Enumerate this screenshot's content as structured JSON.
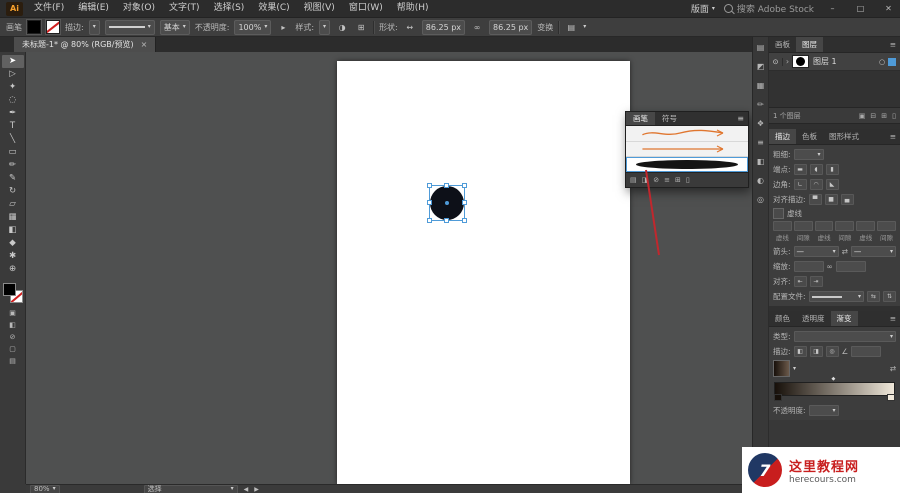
{
  "colors": {
    "accent_blue": "#4f9bd8",
    "annotation_red": "#c1272d",
    "brush_orange": "#e0762f",
    "watermark_red": "#c81e1e",
    "watermark_navy": "#203864",
    "object_fill": "#0d1018"
  },
  "icons": {
    "caret_down": "▾",
    "caret_right": "▸",
    "menu": "≡",
    "swap": "⇄",
    "link": "∞",
    "width": "↔",
    "angle": "∠",
    "expand": "›",
    "eye": "⊙",
    "target": "○",
    "prev": "◀",
    "next": "▶",
    "minimize": "–",
    "maximize": "□",
    "close": "✕",
    "tab_close": "×",
    "recolor": "◑",
    "align_grid": "⊞",
    "more": "▤",
    "diamond": "◆",
    "flip_h": "⇆",
    "flip_v": "⇅"
  },
  "menubar": {
    "logo": "Ai",
    "items": [
      {
        "label": "文件(F)"
      },
      {
        "label": "编辑(E)"
      },
      {
        "label": "对象(O)"
      },
      {
        "label": "文字(T)"
      },
      {
        "label": "选择(S)"
      },
      {
        "label": "效果(C)"
      },
      {
        "label": "视图(V)"
      },
      {
        "label": "窗口(W)"
      },
      {
        "label": "帮助(H)"
      }
    ],
    "workspace": "版面",
    "search_label": "搜索 Adobe Stock"
  },
  "controlbar": {
    "context_label": "画笔",
    "stroke_label": "描边:",
    "brush_definition": "基本",
    "opacity_label": "不透明度:",
    "opacity_value": "100%",
    "style_label": "样式:",
    "shape_label": "形状:",
    "width_value": "86.25 px",
    "height_value": "86.25 px",
    "transform_label": "变换"
  },
  "tabbar": {
    "title": "未标题-1* @ 80% (RGB/预览)"
  },
  "toolbar": {
    "tools": [
      {
        "name": "selection",
        "glyph": "➤"
      },
      {
        "name": "direct-selection",
        "glyph": "▷"
      },
      {
        "name": "magic-wand",
        "glyph": "✦"
      },
      {
        "name": "lasso",
        "glyph": "◌"
      },
      {
        "name": "pen",
        "glyph": "✒"
      },
      {
        "name": "type",
        "glyph": "T"
      },
      {
        "name": "line-segment",
        "glyph": "╲"
      },
      {
        "name": "rectangle",
        "glyph": "▭"
      },
      {
        "name": "paintbrush",
        "glyph": "✏"
      },
      {
        "name": "pencil",
        "glyph": "✎"
      },
      {
        "name": "rotate",
        "glyph": "↻"
      },
      {
        "name": "scale",
        "glyph": "▱"
      },
      {
        "name": "mesh",
        "glyph": "▦"
      },
      {
        "name": "gradient",
        "glyph": "◧"
      },
      {
        "name": "eyedropper",
        "glyph": "◆"
      },
      {
        "name": "hand",
        "glyph": "✱"
      },
      {
        "name": "zoom",
        "glyph": "⊕"
      }
    ],
    "mode_icons": [
      {
        "name": "color-fill-button",
        "glyph": "▣"
      },
      {
        "name": "color-gradient-button",
        "glyph": "◧"
      },
      {
        "name": "color-none-button",
        "glyph": "⊘"
      },
      {
        "name": "draw-mode-button",
        "glyph": "▢"
      },
      {
        "name": "screen-mode-button",
        "glyph": "▤"
      }
    ]
  },
  "float_panel": {
    "tabs": [
      {
        "label": "画笔"
      },
      {
        "label": "符号"
      }
    ],
    "footer_icons": [
      {
        "name": "brush-libraries-icon",
        "glyph": "▤"
      },
      {
        "name": "libraries-panel-icon",
        "glyph": "◨"
      },
      {
        "name": "remove-brush-stroke-icon",
        "glyph": "⊘"
      },
      {
        "name": "options-icon",
        "glyph": "≡"
      },
      {
        "name": "new-brush-icon",
        "glyph": "⊞"
      },
      {
        "name": "delete-brush-icon",
        "glyph": "▯"
      }
    ]
  },
  "dock": {
    "strip_icons": [
      {
        "name": "color-panel-icon",
        "glyph": "▤"
      },
      {
        "name": "color-guide-icon",
        "glyph": "◩"
      },
      {
        "name": "swatches-panel-icon",
        "glyph": "▦"
      },
      {
        "name": "brushes-panel-icon",
        "glyph": "✏"
      },
      {
        "name": "symbols-panel-icon",
        "glyph": "❖"
      },
      {
        "name": "stroke-panel-icon",
        "glyph": "≡"
      },
      {
        "name": "gradient-panel-icon",
        "glyph": "◧"
      },
      {
        "name": "transparency-panel-icon",
        "glyph": "◐"
      },
      {
        "name": "appearance-panel-icon",
        "glyph": "◎"
      }
    ],
    "layers": {
      "tabs": [
        {
          "label": "画板"
        },
        {
          "label": "图层"
        }
      ],
      "layer_name": "图层 1",
      "status": "1 个图层",
      "footer_icons": [
        {
          "name": "make-clipping-mask-icon",
          "glyph": "▣"
        },
        {
          "name": "new-sublayer-icon",
          "glyph": "⊟"
        },
        {
          "name": "new-layer-icon",
          "glyph": "⊞"
        },
        {
          "name": "delete-layer-icon",
          "glyph": "▯"
        }
      ]
    },
    "stroke": {
      "tabs": [
        {
          "label": "描边"
        },
        {
          "label": "色板"
        },
        {
          "label": "图形样式"
        }
      ],
      "weight_label": "粗细:",
      "cap_label": "端点:",
      "corner_label": "边角:",
      "align_label": "对齐描边:",
      "dash_label": "虚线",
      "dash_field_labels": [
        "虚线",
        "间隙",
        "虚线",
        "间隙",
        "虚线",
        "间隙"
      ],
      "arrow_label": "箭头:",
      "arrow_value": "—",
      "scale_label": "缩放:",
      "align2_label": "对齐:",
      "profile_label": "配置文件:",
      "cap_glyphs": [
        "▬",
        "◖",
        "▮"
      ],
      "corner_glyphs": [
        "∟",
        "◠",
        "◣"
      ],
      "align_glyphs": [
        "▀",
        "■",
        "▄"
      ],
      "align2_glyphs": [
        "⇤",
        "⇥"
      ]
    },
    "gradient": {
      "tabs": [
        {
          "label": "颜色"
        },
        {
          "label": "透明度"
        },
        {
          "label": "渐变"
        }
      ],
      "type_label": "类型:",
      "stroke_label": "描边:",
      "stroke_glyphs": [
        "◧",
        "◨",
        "◎"
      ],
      "opacity_label": "不透明度:"
    }
  },
  "statusbar": {
    "zoom": "80%",
    "status": "选择"
  },
  "watermark": {
    "logo_glyph": "7",
    "site_name": "这里教程网",
    "domain": "herecours.com"
  }
}
